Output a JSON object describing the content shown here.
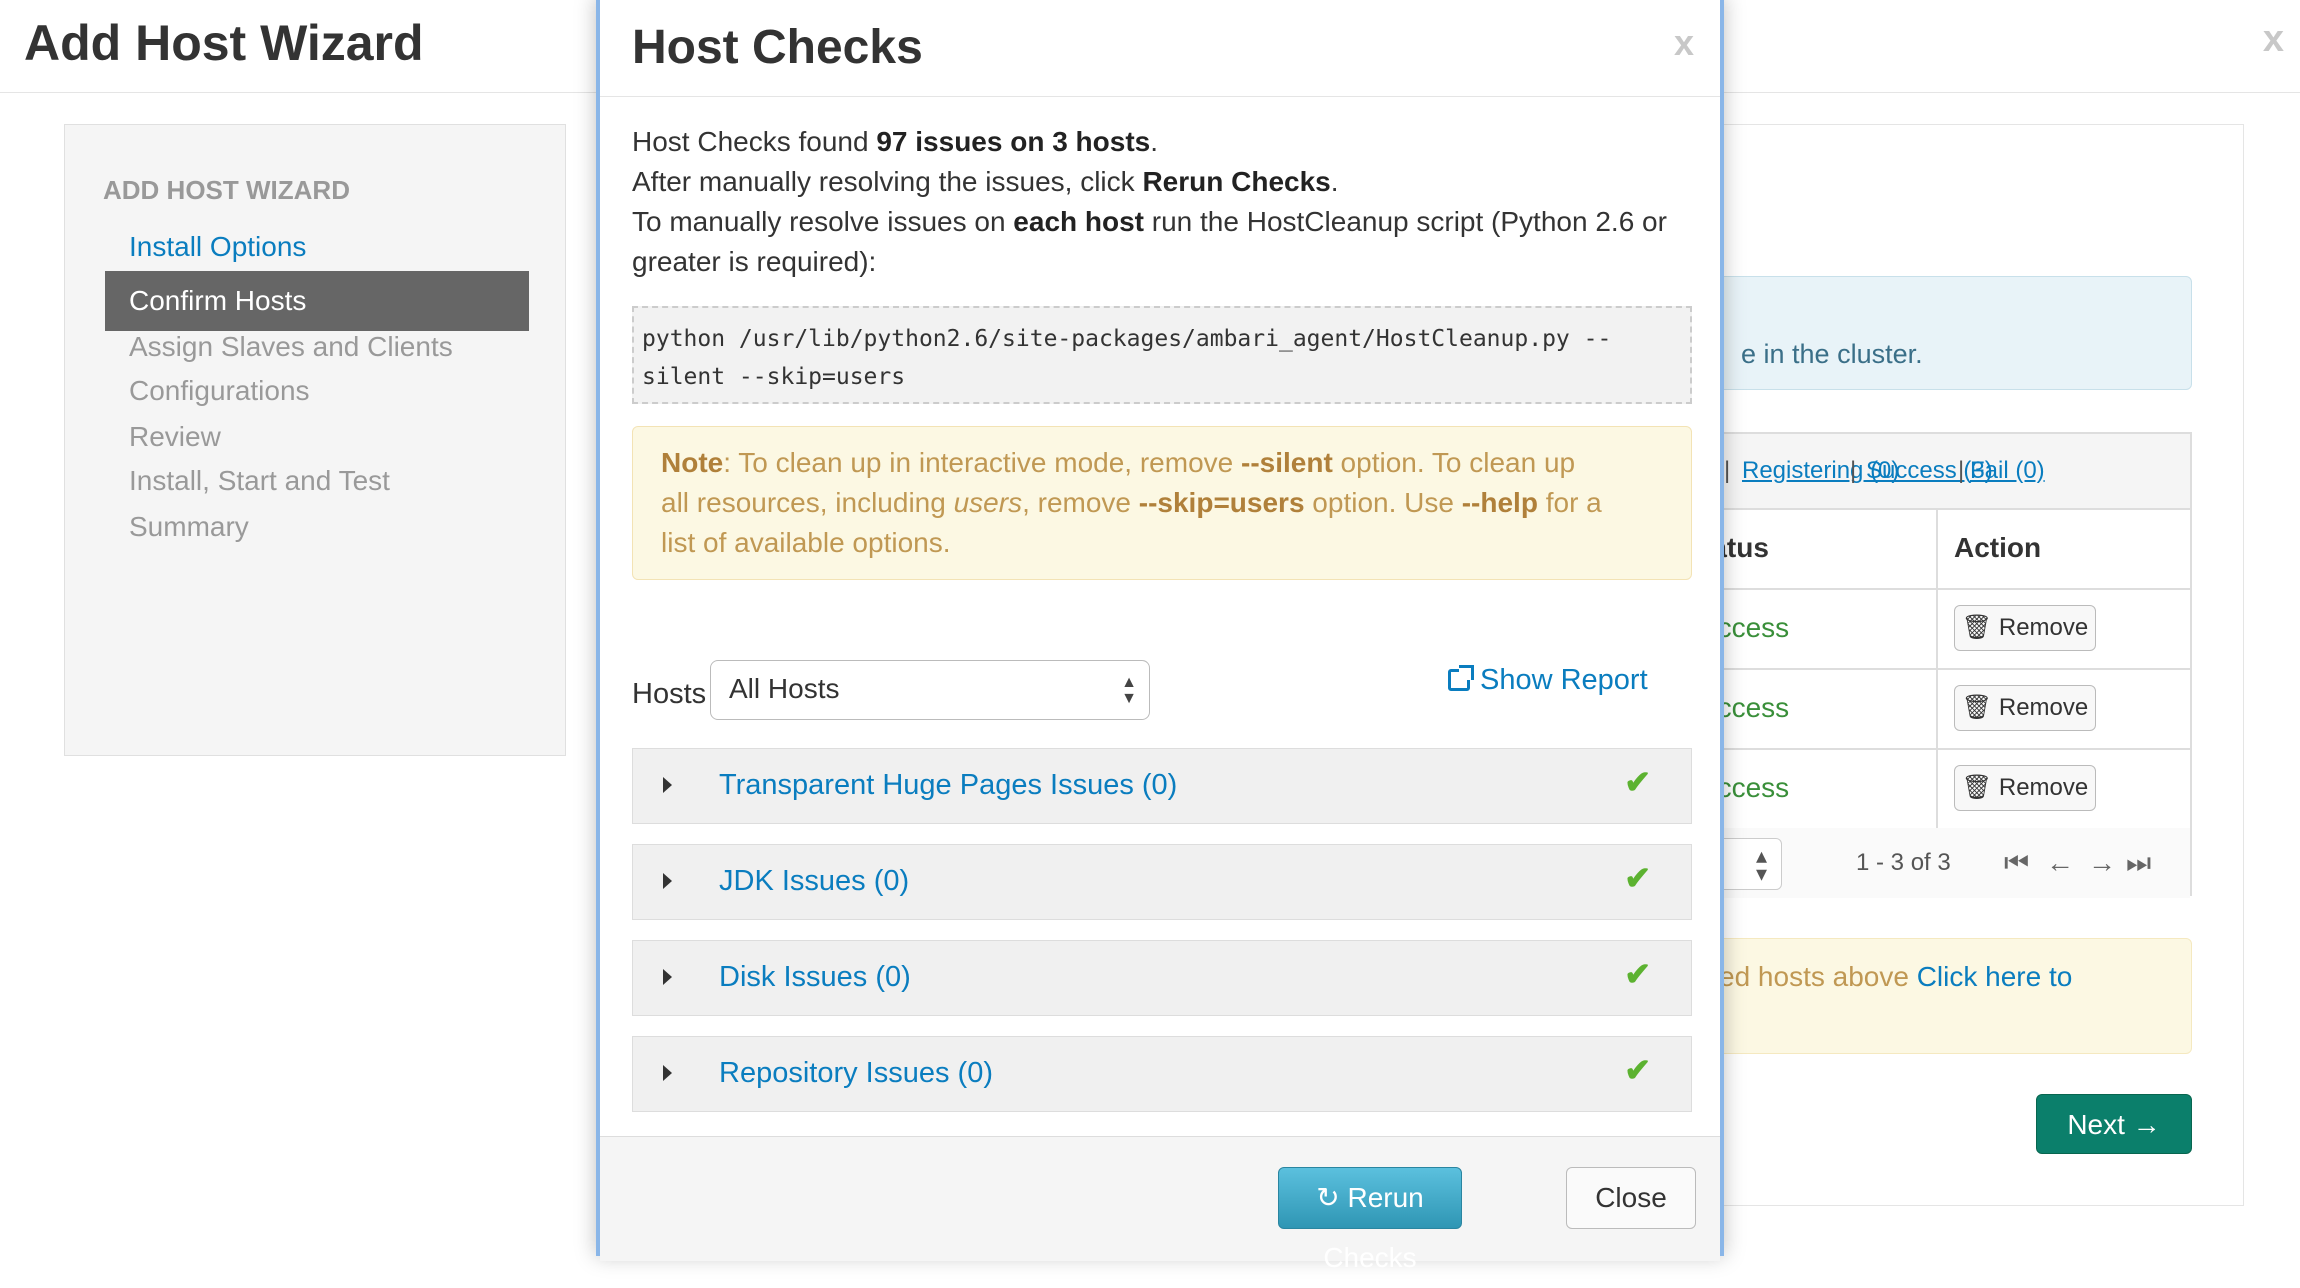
{
  "background": {
    "title": "Add Host Wizard",
    "close_label": "x",
    "nav": {
      "header": "ADD HOST WIZARD",
      "items": [
        {
          "label": "Install Options"
        },
        {
          "label": "Confirm Hosts"
        },
        {
          "label": "Assign Slaves and Clients"
        },
        {
          "label": "Configurations"
        },
        {
          "label": "Review"
        },
        {
          "label": "Install, Start and Test"
        },
        {
          "label": "Summary"
        }
      ]
    },
    "info_text": "e in the cluster.",
    "filters": {
      "first_fragment": ")",
      "registering": "Registering (0)",
      "success": "Success (3)",
      "fail": "Fail (0)",
      "sep": "|"
    },
    "table": {
      "col_status": "tatus",
      "col_action": "Action",
      "rows": [
        {
          "status": "uccess",
          "action": "Remove"
        },
        {
          "status": "uccess",
          "action": "Remove"
        },
        {
          "status": "uccess",
          "action": "Remove"
        }
      ]
    },
    "pager": {
      "range": "1 - 3 of 3",
      "first": "⏮",
      "prev": "←",
      "next": "→",
      "last": "⏭"
    },
    "warn": {
      "text": "ed hosts above ",
      "link": "Click here to"
    },
    "next_button": "Next →"
  },
  "modal": {
    "title": "Host Checks",
    "close_label": "x",
    "line1_prefix": "Host Checks found ",
    "line1_bold": "97 issues on 3 hosts",
    "line1_suffix": ".",
    "line2_prefix": "After manually resolving the issues, click ",
    "line2_bold": "Rerun Checks",
    "line2_suffix": ".",
    "line3_prefix": "To manually resolve issues on ",
    "line3_bold": "each host",
    "line3_suffix": " run the HostCleanup script (Python 2.6 or",
    "line4": "greater is required):",
    "code_line1": "python /usr/lib/python2.6/site-packages/ambari_agent/HostCleanup.py --",
    "code_line2": "silent --skip=users",
    "note": {
      "note_label": "Note",
      "t1": ": To clean up in interactive mode, remove ",
      "b1": "--silent",
      "t2": " option. To clean up",
      "t3": "all resources, including ",
      "i1": "users",
      "t4": ", remove ",
      "b2": "--skip=users",
      "t5": " option. Use ",
      "b3": "--help",
      "t6": " for a",
      "t7": "list of available options."
    },
    "hosts_label": "Hosts",
    "hosts_select_value": "All Hosts",
    "show_report": "Show Report",
    "issues": [
      {
        "label": "Transparent Huge Pages Issues (0)",
        "status": "ok"
      },
      {
        "label": "JDK Issues (0)",
        "status": "ok"
      },
      {
        "label": "Disk Issues (0)",
        "status": "ok"
      },
      {
        "label": "Repository Issues (0)",
        "status": "ok"
      }
    ],
    "rerun_button": "Rerun Checks",
    "close_button": "Close"
  },
  "colors": {
    "link": "#0a7dbf",
    "success": "#3a8f3a",
    "check": "#5cb230",
    "next_button": "#0b7f6b",
    "rerun_button": "#2f96b4"
  }
}
